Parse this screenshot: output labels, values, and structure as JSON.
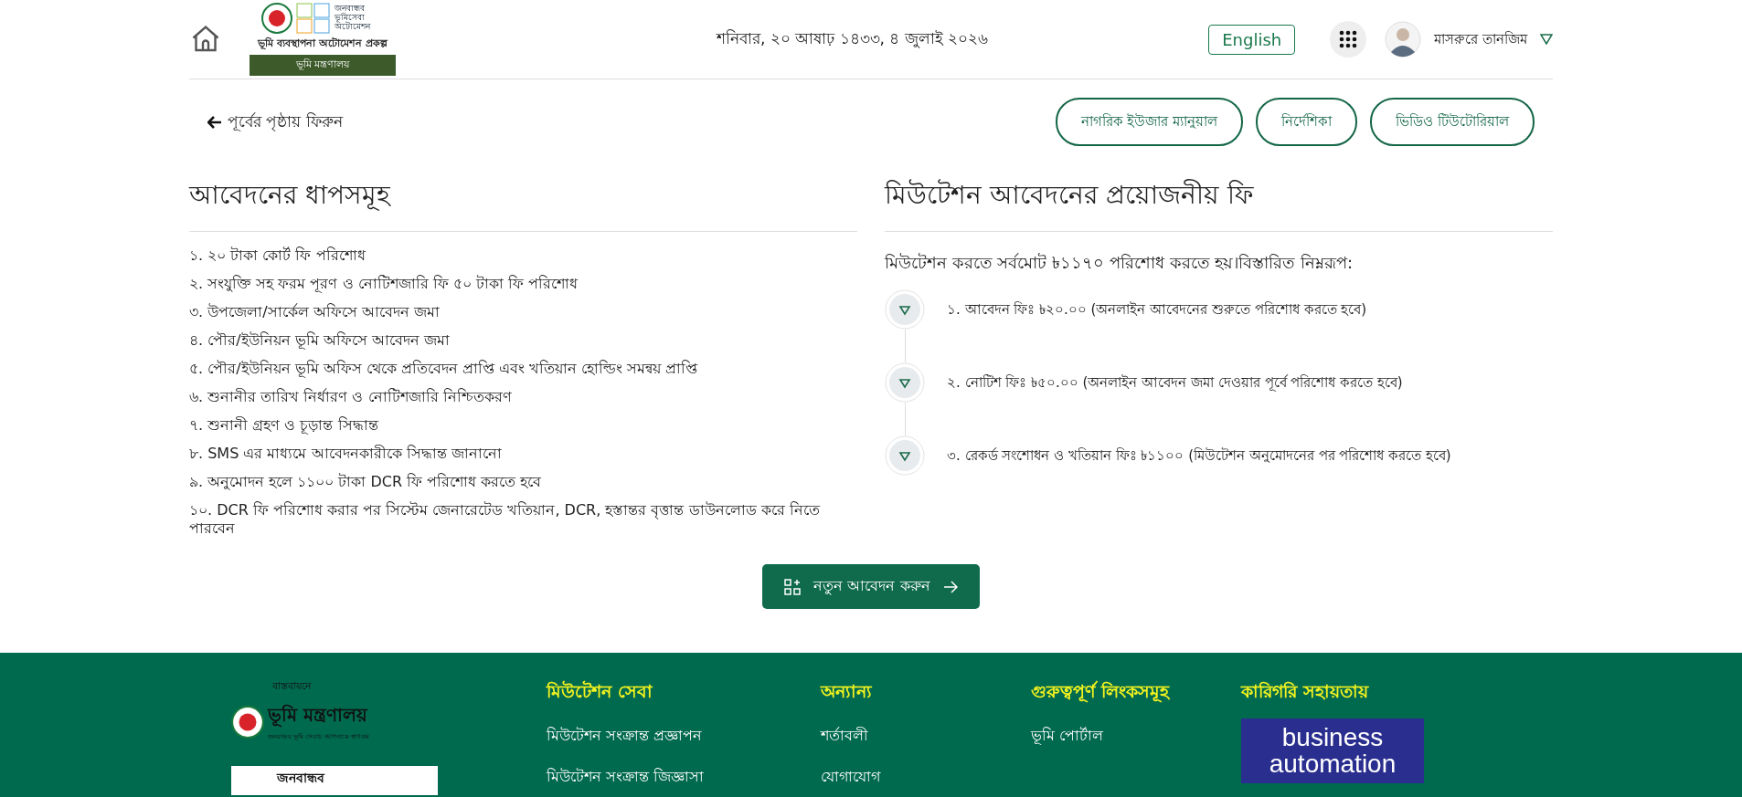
{
  "header": {
    "logo": {
      "title": "ভূমি ব্যবস্থাপনা অটোমেশন প্রকল্প",
      "ministry": "ভূমি মন্ত্রণালয়",
      "badge_text": "জনবান্ধব ভূমিসেবা অটোমেশন"
    },
    "date": "শনিবার, ২০ আষাঢ় ১৪৩৩, ৪ জুলাই ২০২৬",
    "language_button": "English",
    "user_name": "মাসরুরে তানজিম"
  },
  "back_link": "পূর্বের পৃষ্ঠায় ফিরুন",
  "help_buttons": [
    "নাগরিক ইউজার ম্যানুয়াল",
    "নির্দেশিকা",
    "ভিডিও টিউটোরিয়াল"
  ],
  "steps": {
    "title": "আবেদনের ধাপসমূহ",
    "items": [
      "১. ২০ টাকা কোর্ট ফি পরিশোধ",
      "২. সংযুক্তি সহ ফরম পূরণ ও নোটিশজারি ফি ৫০ টাকা ফি পরিশোধ",
      "৩. উপজেলা/সার্কেল অফিসে আবেদন জমা",
      "৪. পৌর/ইউনিয়ন ভূমি অফিসে আবেদন জমা",
      "৫. পৌর/ইউনিয়ন ভূমি অফিস থেকে প্রতিবেদন প্রাপ্তি এবং খতিয়ান হোল্ডিং সমন্বয় প্রাপ্তি",
      "৬. শুনানীর তারিখ নির্ধারণ ও নোটিশজারি নিশ্চিতকরণ",
      "৭. শুনানী গ্রহণ ও চূড়ান্ত সিদ্ধান্ত",
      "৮. SMS এর মাধ্যমে আবেদনকারীকে সিদ্ধান্ত জানানো",
      "৯. অনুমোদন হলে ১১০০ টাকা DCR ফি পরিশোধ করতে হবে",
      "১০. DCR ফি পরিশোধ করার পর সিস্টেম জেনারেটেড খতিয়ান, DCR, হস্তান্তর বৃত্তান্ত ডাউনলোড করে নিতে পারবেন"
    ]
  },
  "fees": {
    "title": "মিউটেশন আবেদনের প্রয়োজনীয় ফি",
    "summary": "মিউটেশন করতে সর্বমোট ৳১১৭০ পরিশোধ করতে হয়।বিস্তারিত নিম্নরূপ:",
    "items": [
      "১. আবেদন ফিঃ ৳২০.০০ (অনলাইন আবেদনের শুরুতে পরিশোধ করতে হবে)",
      "২. নোটিশ ফিঃ ৳৫০.০০ (অনলাইন আবেদন জমা দেওয়ার পূর্বে পরিশোধ করতে হবে)",
      "৩. রেকর্ড সংশোধন ও খতিয়ান ফিঃ ৳১১০০ (মিউটেশন অনুমোদনের পর পরিশোধ করতে হবে)"
    ]
  },
  "new_application_button": "নতুন আবেদন করুন",
  "footer": {
    "implementer_label": "বাস্তবায়নে",
    "ministry_logo": {
      "name": "ভূমি মন্ত্রণালয়",
      "tagline": "জনবান্ধব ভূমি সেবায় আপনাকে স্বাগতম"
    },
    "partner_logo": "জনবান্ধব",
    "columns": [
      {
        "title": "মিউটেশন সেবা",
        "links": [
          "মিউটেশন সংক্রান্ত প্রজ্ঞাপন",
          "মিউটেশন সংক্রান্ত জিজ্ঞাসা"
        ]
      },
      {
        "title": "অন্যান্য",
        "links": [
          "শর্তাবলী",
          "যোগাযোগ"
        ]
      },
      {
        "title": "গুরুত্বপূর্ণ লিংকসমূহ",
        "links": [
          "ভূমি পোর্টাল"
        ]
      },
      {
        "title": "কারিগরি সহায়তায়",
        "sponsor": [
          "business",
          "automation"
        ]
      }
    ]
  }
}
